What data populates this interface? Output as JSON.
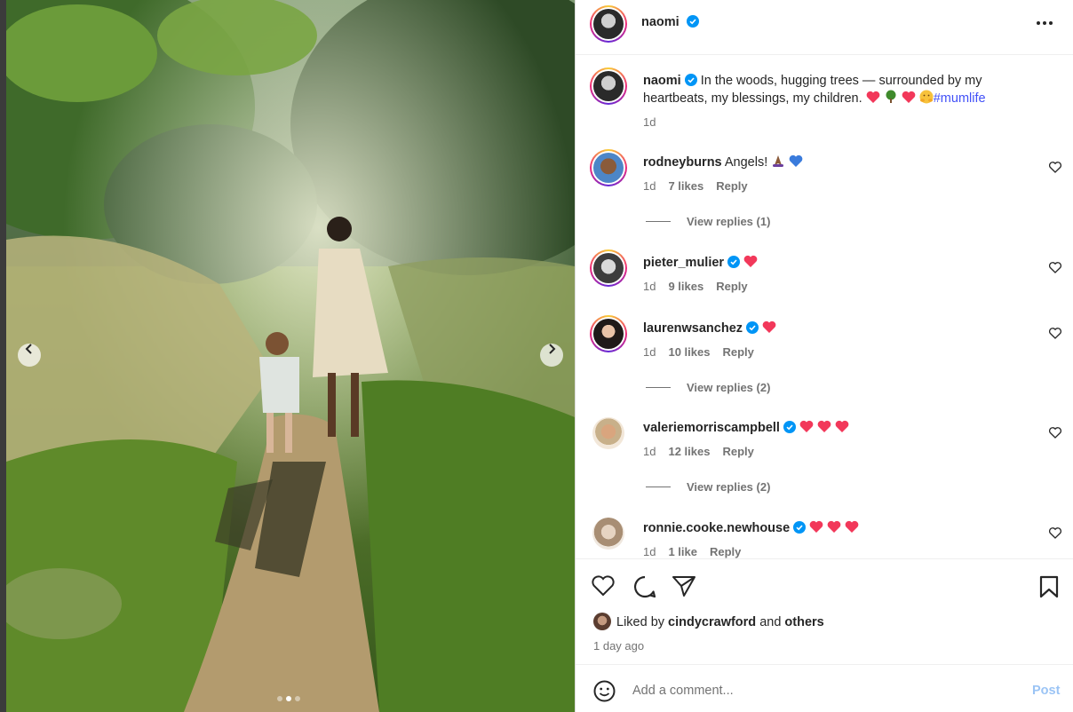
{
  "post": {
    "author": "naomi",
    "caption": {
      "username": "naomi",
      "text_line1": "In the woods, hugging trees — surrounded by my",
      "text_line2": "heartbeats, my blessings, my children.",
      "hashtag": "#mumlife",
      "age": "1d"
    }
  },
  "comments": [
    {
      "username": "rodneyburns",
      "verified": false,
      "text": "Angels!",
      "age": "1d",
      "likes": "7 likes",
      "reply": "Reply",
      "view_replies": "View replies (1)"
    },
    {
      "username": "pieter_mulier",
      "verified": true,
      "text": "",
      "age": "1d",
      "likes": "9 likes",
      "reply": "Reply",
      "view_replies": ""
    },
    {
      "username": "laurenwsanchez",
      "verified": true,
      "text": "",
      "age": "1d",
      "likes": "10 likes",
      "reply": "Reply",
      "view_replies": "View replies (2)"
    },
    {
      "username": "valeriemorriscampbell",
      "verified": true,
      "text": "",
      "age": "1d",
      "likes": "12 likes",
      "reply": "Reply",
      "view_replies": "View replies (2)"
    },
    {
      "username": "ronnie.cooke.newhouse",
      "verified": true,
      "text": "",
      "age": "1d",
      "likes": "1 like",
      "reply": "Reply",
      "view_replies": ""
    }
  ],
  "likes_summary": {
    "prefix": "Liked by",
    "user": "cindycrawford",
    "joiner": "and",
    "others": "others"
  },
  "time_ago": "1 day ago",
  "composer": {
    "placeholder": "Add a comment...",
    "post_label": "Post"
  },
  "carousel": {
    "count": 3,
    "active_index": 1
  },
  "colors": {
    "accent": "#0095f6",
    "link": "#4150f7",
    "heart": "#ff3040"
  }
}
